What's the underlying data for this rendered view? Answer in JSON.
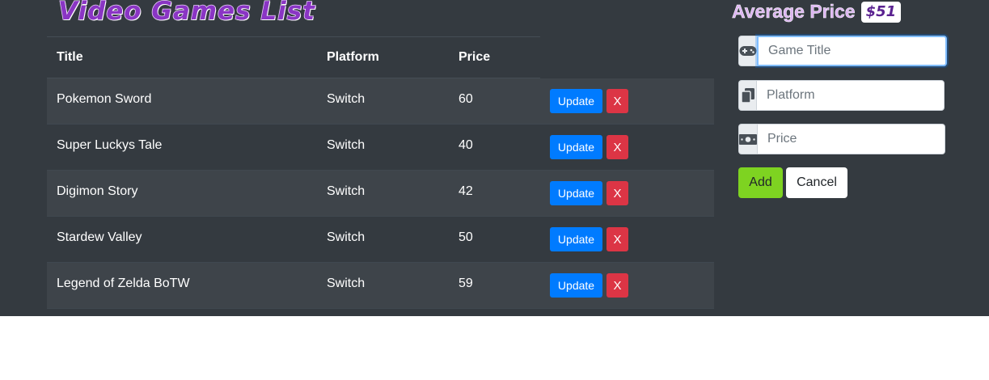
{
  "header": {
    "title": "Video Games List",
    "avg_label": "Average Price",
    "avg_value": "$51"
  },
  "table": {
    "columns": [
      "Title",
      "Platform",
      "Price"
    ],
    "rows": [
      {
        "title": "Pokemon Sword",
        "platform": "Switch",
        "price": "60"
      },
      {
        "title": "Super Luckys Tale",
        "platform": "Switch",
        "price": "40"
      },
      {
        "title": "Digimon Story",
        "platform": "Switch",
        "price": "42"
      },
      {
        "title": "Stardew Valley",
        "platform": "Switch",
        "price": "50"
      },
      {
        "title": "Legend of Zelda BoTW",
        "platform": "Switch",
        "price": "59"
      }
    ],
    "update_label": "Update",
    "delete_label": "X"
  },
  "form": {
    "title_placeholder": "Game Title",
    "platform_placeholder": "Platform",
    "price_placeholder": "Price",
    "add_label": "Add",
    "cancel_label": "Cancel"
  },
  "icons": {
    "title": "gamepad-icon",
    "platform": "copy-icon",
    "price": "money-bill-icon"
  },
  "colors": {
    "background": "#343a40",
    "update": "#007bff",
    "delete": "#dc3545",
    "add": "#7ed321",
    "title": "#8a35c4"
  }
}
